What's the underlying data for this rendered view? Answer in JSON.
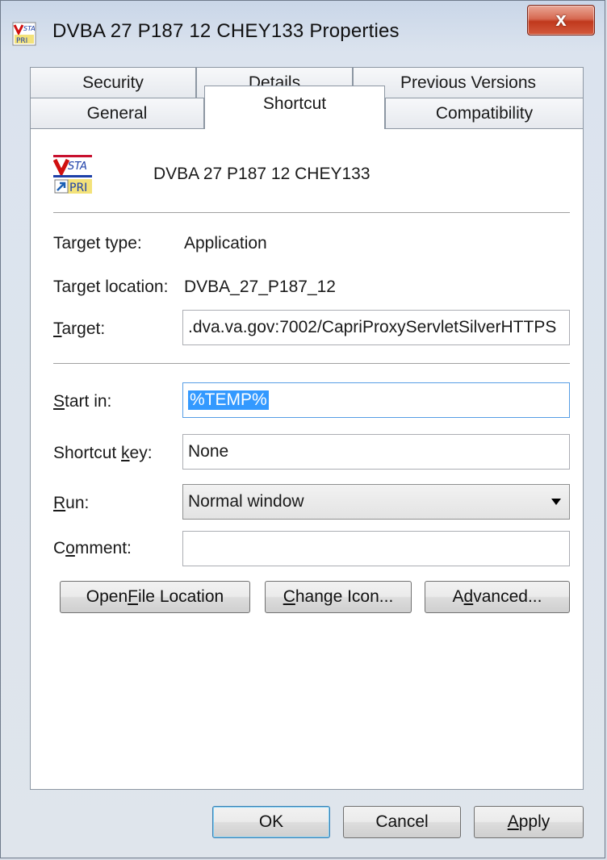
{
  "window": {
    "title": "DVBA 27 P187 12 CHEY133 Properties",
    "close_label": "x"
  },
  "tabs": {
    "row1": [
      "Security",
      "Details",
      "Previous Versions"
    ],
    "row2": [
      "General",
      "Shortcut",
      "Compatibility"
    ],
    "active": "Shortcut"
  },
  "shortcut": {
    "name": "DVBA 27 P187 12 CHEY133",
    "icon_name": "vista-shortcut-icon",
    "target_type_label": "Target type:",
    "target_type": "Application",
    "target_location_label": "Target location:",
    "target_location": "DVBA_27_P187_12",
    "target_label": "Target:",
    "target_value": ".dva.va.gov:7002/CapriProxyServletSilverHTTPS",
    "start_in_label": "Start in:",
    "start_in_value": "%TEMP%",
    "shortcut_key_label": "Shortcut key:",
    "shortcut_key_value": "None",
    "run_label": "Run:",
    "run_value": "Normal window",
    "comment_label": "Comment:",
    "comment_value": ""
  },
  "buttons": {
    "open_file_location": "Open File Location",
    "change_icon": "Change Icon...",
    "advanced": "Advanced...",
    "ok": "OK",
    "cancel": "Cancel",
    "apply": "Apply"
  },
  "colors": {
    "selection": "#3399ff",
    "close_button": "#c0381c",
    "panel_bg": "#ffffff",
    "focus_border": "#569de5"
  }
}
